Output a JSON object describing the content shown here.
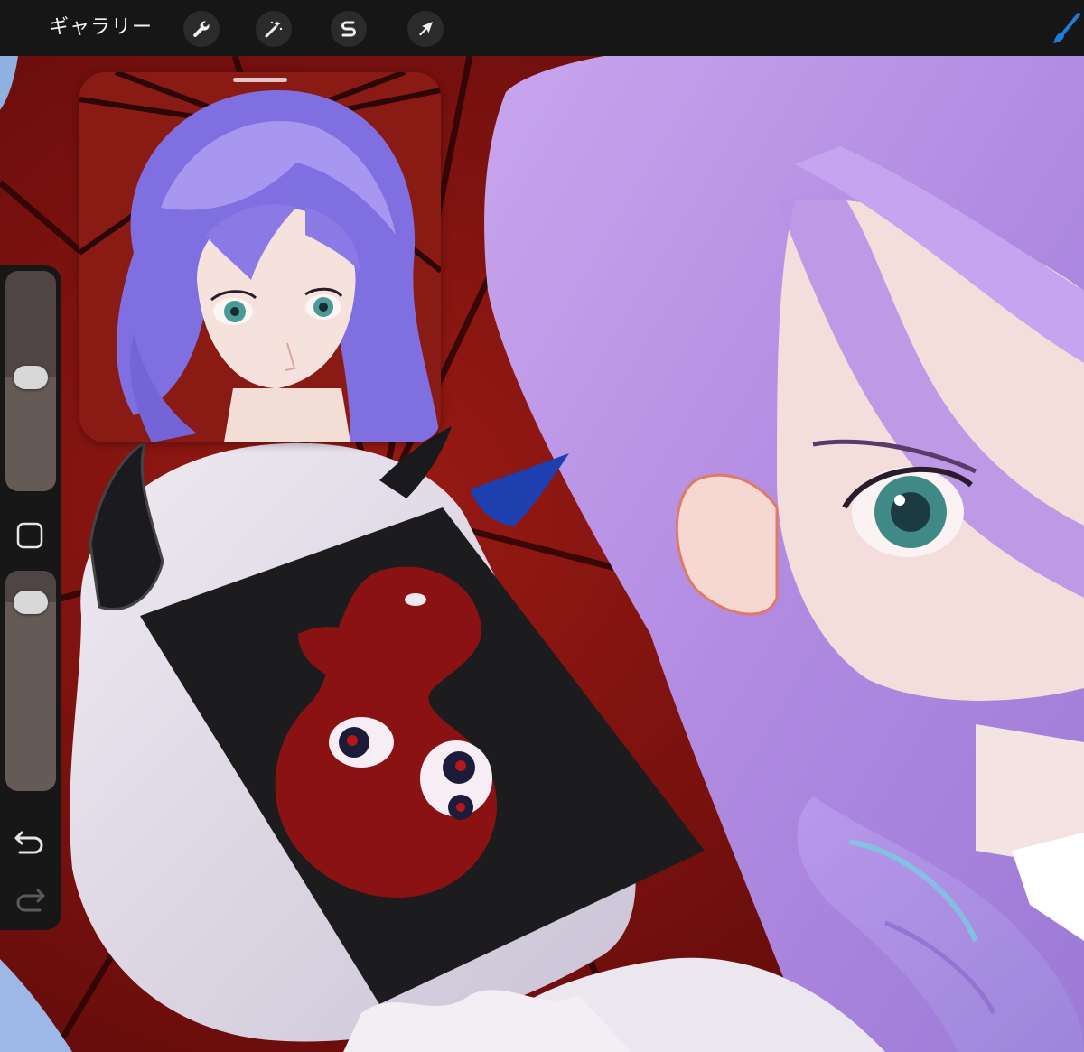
{
  "topbar": {
    "gallery_label": "ギャラリー",
    "tools": [
      {
        "icon": "wrench-icon",
        "name": "actions"
      },
      {
        "icon": "magic-wand-icon",
        "name": "adjustments"
      },
      {
        "icon": "selection-s-icon",
        "name": "selection"
      },
      {
        "icon": "arrow-cursor-icon",
        "name": "transform"
      }
    ],
    "brush_icon": "brush-icon",
    "accent": "#1e7bd8"
  },
  "sidebar": {
    "brush_size_level": 0.52,
    "opacity_level": 0.92,
    "modify_icon": "square-icon",
    "undo_icon": "undo-arrow-icon",
    "redo_icon": "redo-arrow-icon"
  },
  "colors": {
    "umbrella_red": "#7a1010",
    "hair_lavender": "#b996e6",
    "skin": "#f1dcd8",
    "mascot_white": "#e4dcea"
  }
}
